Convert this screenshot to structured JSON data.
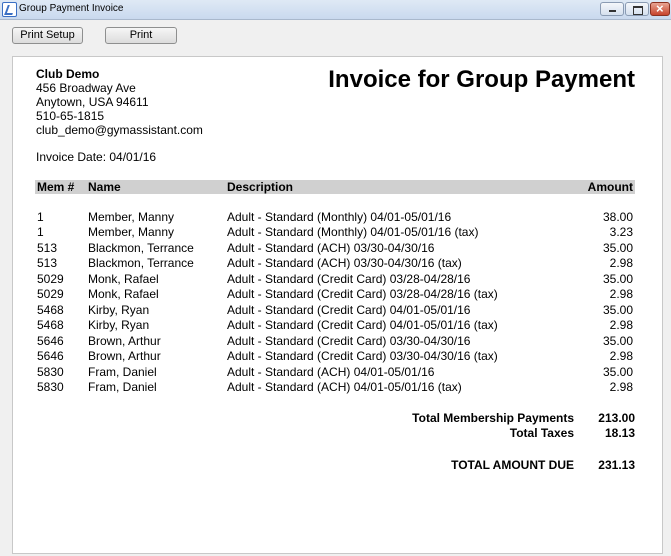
{
  "window": {
    "title": "Group Payment Invoice"
  },
  "toolbar": {
    "print_setup_label": "Print Setup",
    "print_label": "Print"
  },
  "club": {
    "name": "Club Demo",
    "address_lines": [
      "456 Broadway Ave",
      "Anytown, USA 94611",
      "510-65-1815",
      "club_demo@gymassistant.com"
    ]
  },
  "invoice": {
    "title": "Invoice for Group Payment",
    "date_text": "Invoice Date: 04/01/16"
  },
  "table": {
    "headers": {
      "mem": "Mem #",
      "name": "Name",
      "description": "Description",
      "amount": "Amount"
    },
    "rows": [
      {
        "mem": "1",
        "name": "Member, Manny",
        "description": "Adult - Standard (Monthly) 04/01-05/01/16",
        "amount": "38.00"
      },
      {
        "mem": "1",
        "name": "Member, Manny",
        "description": "Adult - Standard (Monthly) 04/01-05/01/16 (tax)",
        "amount": "3.23"
      },
      {
        "mem": "513",
        "name": "Blackmon, Terrance",
        "description": "Adult - Standard (ACH) 03/30-04/30/16",
        "amount": "35.00"
      },
      {
        "mem": "513",
        "name": "Blackmon, Terrance",
        "description": "Adult - Standard (ACH) 03/30-04/30/16 (tax)",
        "amount": "2.98"
      },
      {
        "mem": "5029",
        "name": "Monk, Rafael",
        "description": "Adult - Standard (Credit Card) 03/28-04/28/16",
        "amount": "35.00"
      },
      {
        "mem": "5029",
        "name": "Monk, Rafael",
        "description": "Adult - Standard (Credit Card) 03/28-04/28/16 (tax)",
        "amount": "2.98"
      },
      {
        "mem": "5468",
        "name": "Kirby, Ryan",
        "description": "Adult - Standard (Credit Card) 04/01-05/01/16",
        "amount": "35.00"
      },
      {
        "mem": "5468",
        "name": "Kirby, Ryan",
        "description": "Adult - Standard (Credit Card) 04/01-05/01/16 (tax)",
        "amount": "2.98"
      },
      {
        "mem": "5646",
        "name": "Brown, Arthur",
        "description": "Adult - Standard (Credit Card) 03/30-04/30/16",
        "amount": "35.00"
      },
      {
        "mem": "5646",
        "name": "Brown, Arthur",
        "description": "Adult - Standard (Credit Card) 03/30-04/30/16 (tax)",
        "amount": "2.98"
      },
      {
        "mem": "5830",
        "name": "Fram, Daniel",
        "description": "Adult - Standard (ACH) 04/01-05/01/16",
        "amount": "35.00"
      },
      {
        "mem": "5830",
        "name": "Fram, Daniel",
        "description": "Adult - Standard (ACH) 04/01-05/01/16 (tax)",
        "amount": "2.98"
      }
    ]
  },
  "totals": {
    "membership_label": "Total Membership Payments",
    "membership_value": "213.00",
    "taxes_label": "Total Taxes",
    "taxes_value": "18.13",
    "due_label": "TOTAL AMOUNT DUE",
    "due_value": "231.13"
  }
}
